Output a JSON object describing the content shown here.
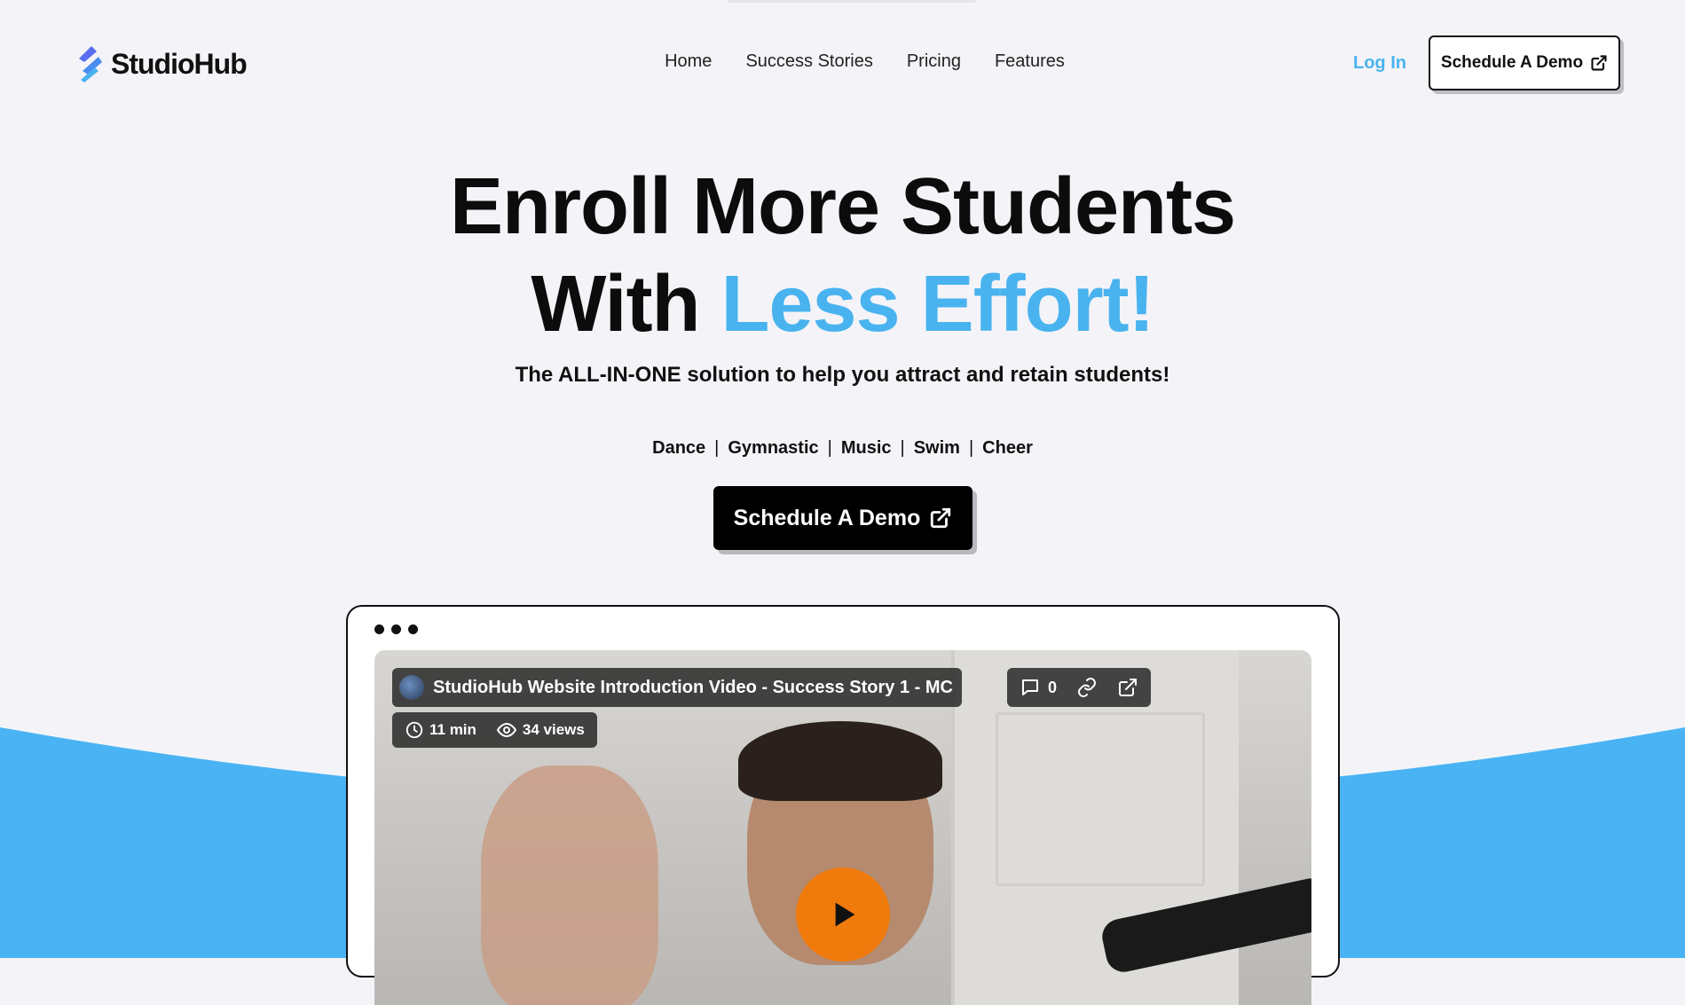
{
  "brand": {
    "name": "StudioHub",
    "accent_color": "#49b3ef",
    "play_color": "#f07a0c"
  },
  "nav": {
    "items": [
      {
        "label": "Home"
      },
      {
        "label": "Success Stories"
      },
      {
        "label": "Pricing"
      },
      {
        "label": "Features"
      }
    ],
    "login_label": "Log In",
    "demo_label": "Schedule A Demo",
    "demo_icon": "external-link-icon"
  },
  "hero": {
    "title_line1": "Enroll More Students",
    "title_line2_plain": "With ",
    "title_line2_accent": "Less Effort!",
    "subtitle": "The ALL-IN-ONE solution to help you attract and retain students!",
    "categories": [
      "Dance",
      "Gymnastic",
      "Music",
      "Swim",
      "Cheer"
    ],
    "separator": "|",
    "cta_label": "Schedule A Demo",
    "cta_icon": "external-link-icon"
  },
  "video": {
    "title": "StudioHub Website Introduction Video - Success Story 1 - MC",
    "comments_count": "0",
    "duration": "11 min",
    "views": "34 views",
    "icons": [
      "comment-icon",
      "link-icon",
      "external-link-icon",
      "clock-icon",
      "eye-icon",
      "play-icon"
    ]
  }
}
